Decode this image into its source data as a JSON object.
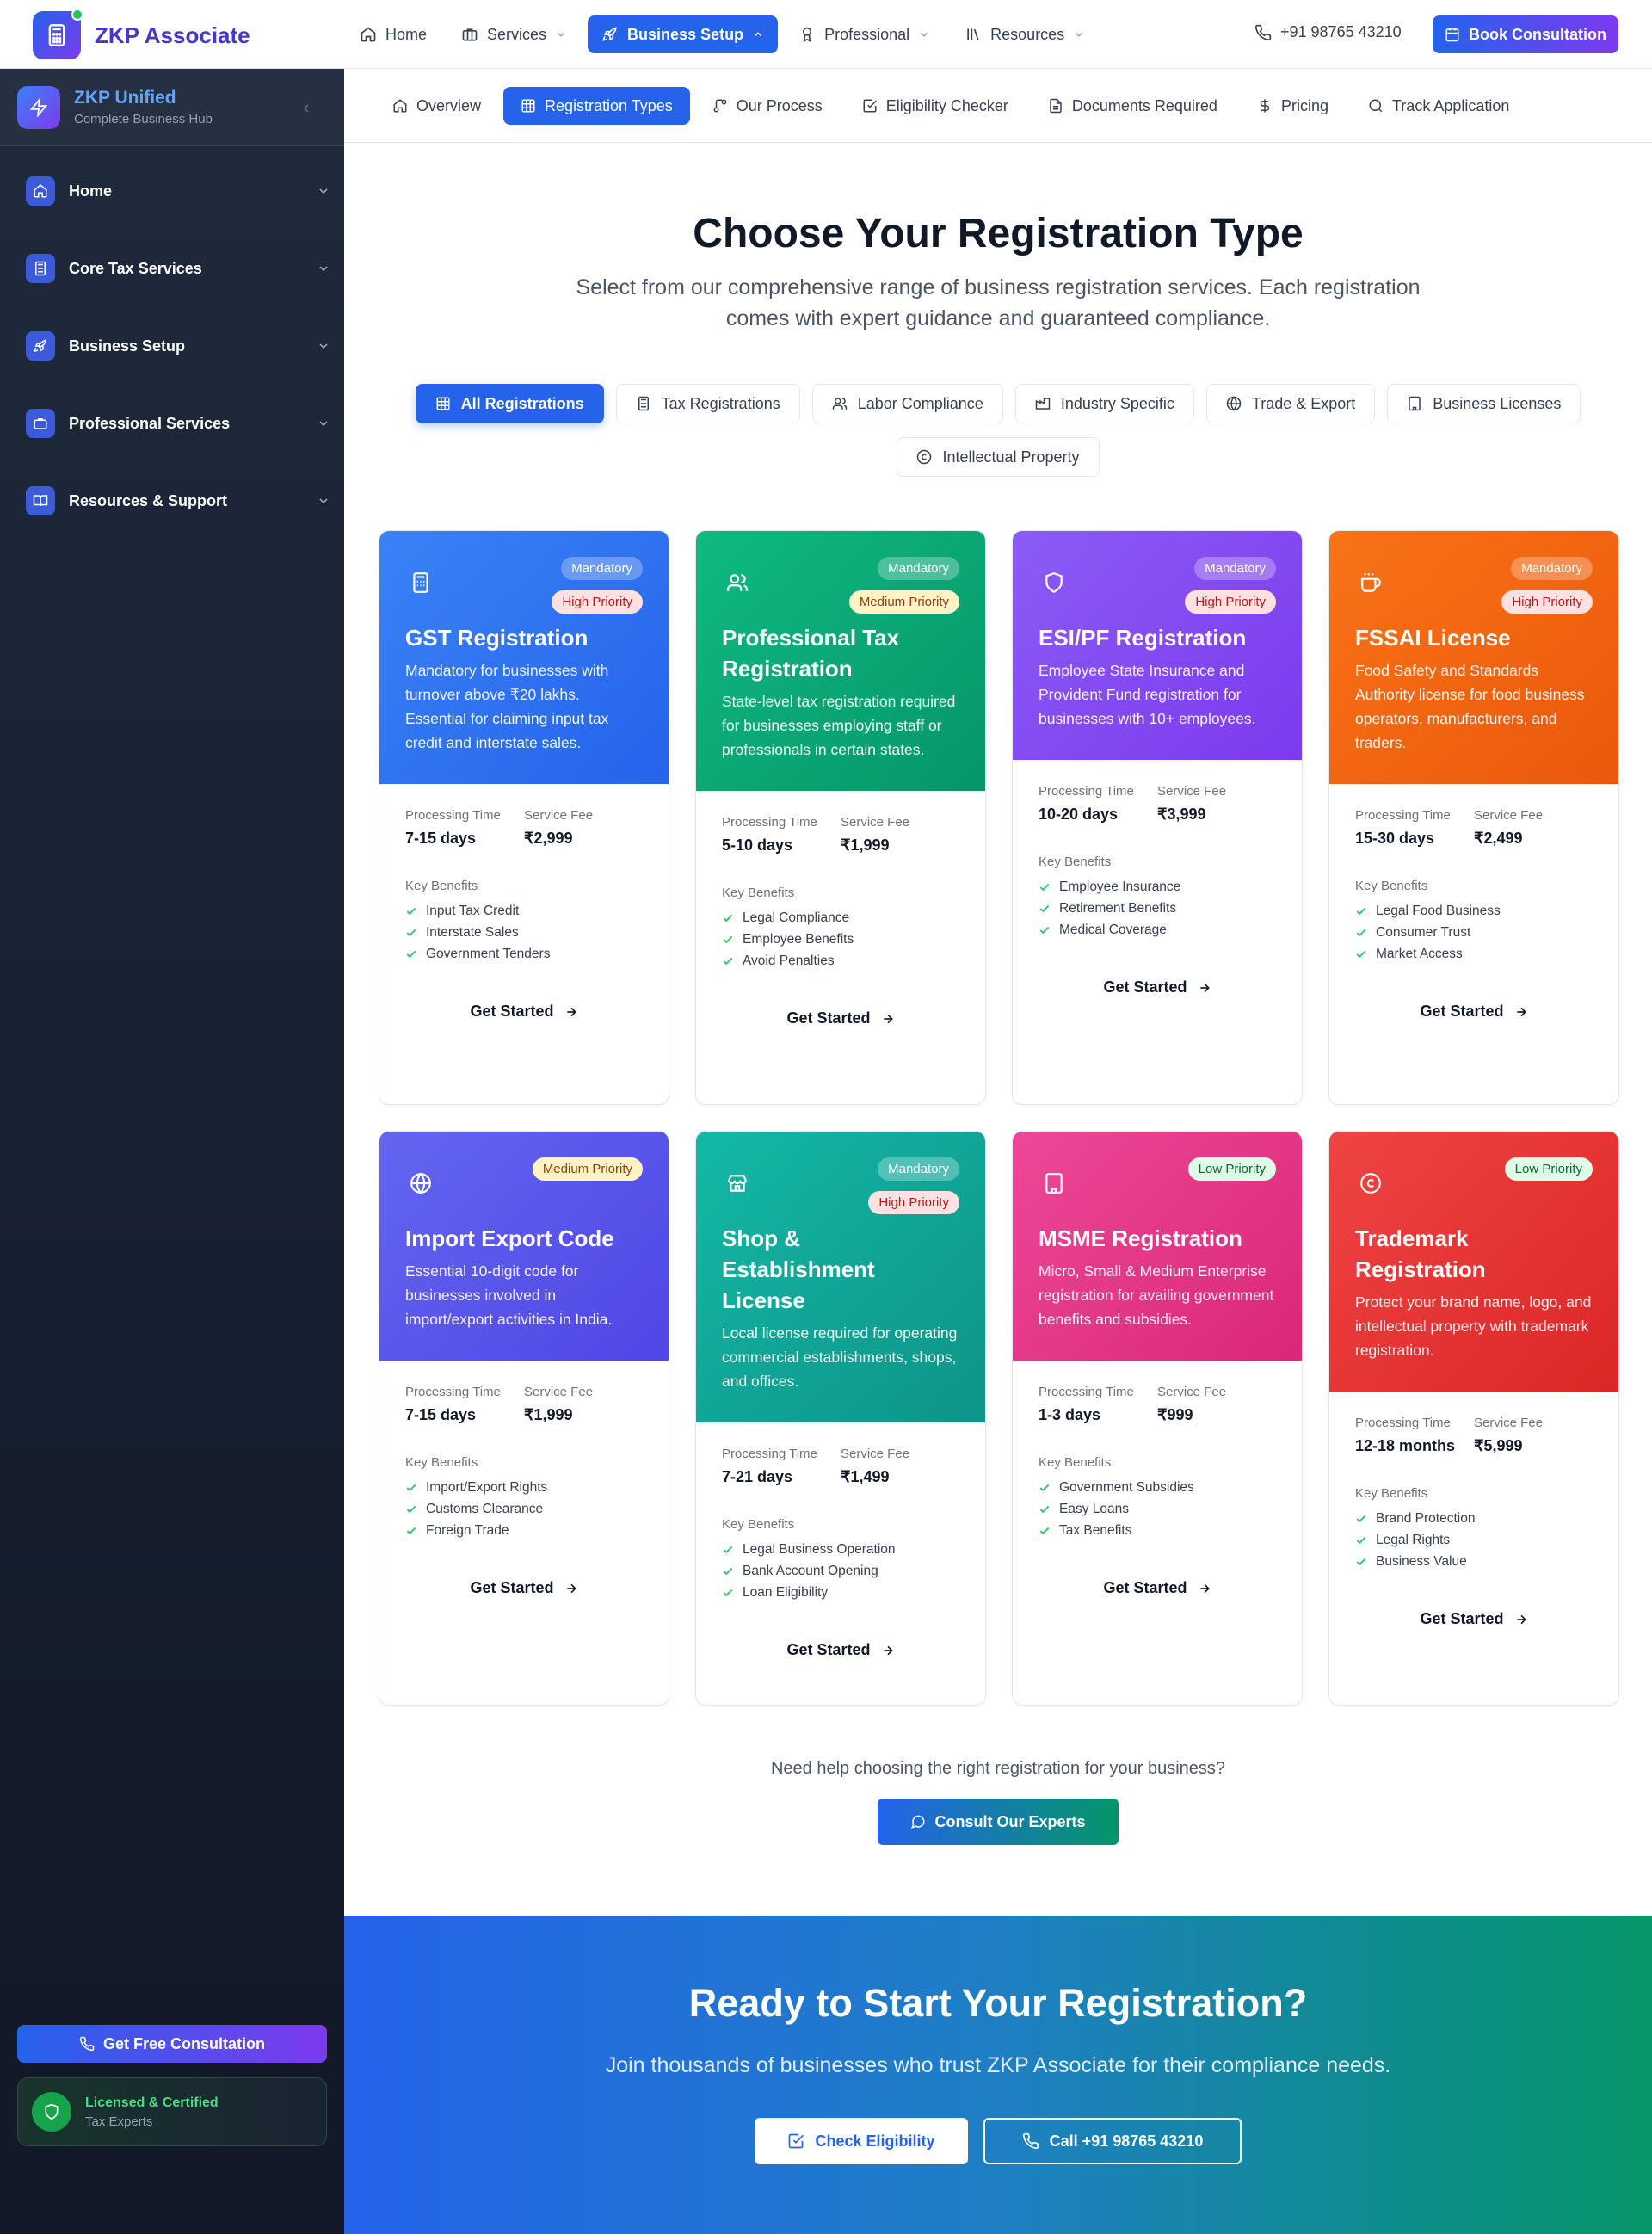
{
  "brand": {
    "name": "ZKP Associate"
  },
  "topnav": {
    "items": [
      {
        "label": "Home",
        "icon": "home-icon"
      },
      {
        "label": "Services",
        "icon": "briefcase-icon"
      },
      {
        "label": "Business Setup",
        "icon": "rocket-icon"
      },
      {
        "label": "Professional",
        "icon": "award-icon"
      },
      {
        "label": "Resources",
        "icon": "library-icon"
      }
    ],
    "active": "Business Setup",
    "phone": "+91 98765 43210",
    "book_label": "Book Consultation"
  },
  "sidebar": {
    "title": "ZKP Unified",
    "subtitle": "Complete Business Hub",
    "items": [
      {
        "label": "Home",
        "icon": "home-icon"
      },
      {
        "label": "Core Tax Services",
        "icon": "calculator-icon"
      },
      {
        "label": "Business Setup",
        "icon": "rocket-icon"
      },
      {
        "label": "Professional Services",
        "icon": "briefcase-icon"
      },
      {
        "label": "Resources & Support",
        "icon": "book-icon"
      }
    ],
    "consult_label": "Get Free Consultation",
    "cert_title": "Licensed & Certified",
    "cert_sub": "Tax Experts"
  },
  "subnav": {
    "tabs": [
      {
        "label": "Overview"
      },
      {
        "label": "Registration Types"
      },
      {
        "label": "Our Process"
      },
      {
        "label": "Eligibility Checker"
      },
      {
        "label": "Documents Required"
      },
      {
        "label": "Pricing"
      },
      {
        "label": "Track Application"
      }
    ],
    "active": "Registration Types"
  },
  "page": {
    "title": "Choose Your Registration Type",
    "lead": "Select from our comprehensive range of business registration services. Each registration comes with expert guidance and guaranteed compliance.",
    "filters": [
      {
        "label": "All Registrations"
      },
      {
        "label": "Tax Registrations"
      },
      {
        "label": "Labor Compliance"
      },
      {
        "label": "Industry Specific"
      },
      {
        "label": "Trade & Export"
      },
      {
        "label": "Business Licenses"
      },
      {
        "label": "Intellectual Property"
      }
    ],
    "active_filter": "All Registrations"
  },
  "labels": {
    "processing_time": "Processing Time",
    "service_fee": "Service Fee",
    "key_benefits": "Key Benefits",
    "get_started": "Get Started"
  },
  "cards": [
    {
      "title": "GST Registration",
      "desc": "Mandatory for businesses with turnover above ₹20 lakhs. Essential for claiming input tax credit and interstate sales.",
      "badges": [
        "Mandatory",
        "High Priority"
      ],
      "time": "7-15 days",
      "fee": "₹2,999",
      "benefits": [
        "Input Tax Credit",
        "Interstate Sales",
        "Government Tenders"
      ],
      "color": "#2563eb",
      "icon": "calculator-icon"
    },
    {
      "title": "Professional Tax Registration",
      "desc": "State-level tax registration required for businesses employing staff or professionals in certain states.",
      "badges": [
        "Mandatory",
        "Medium Priority"
      ],
      "time": "5-10 days",
      "fee": "₹1,999",
      "benefits": [
        "Legal Compliance",
        "Employee Benefits",
        "Avoid Penalties"
      ],
      "color": "#059669",
      "icon": "users-icon"
    },
    {
      "title": "ESI/PF Registration",
      "desc": "Employee State Insurance and Provident Fund registration for businesses with 10+ employees.",
      "badges": [
        "Mandatory",
        "High Priority"
      ],
      "time": "10-20 days",
      "fee": "₹3,999",
      "benefits": [
        "Employee Insurance",
        "Retirement Benefits",
        "Medical Coverage"
      ],
      "color": "#7c3aed",
      "icon": "shield-icon"
    },
    {
      "title": "FSSAI License",
      "desc": "Food Safety and Standards Authority license for food business operators, manufacturers, and traders.",
      "badges": [
        "Mandatory",
        "High Priority"
      ],
      "time": "15-30 days",
      "fee": "₹2,499",
      "benefits": [
        "Legal Food Business",
        "Consumer Trust",
        "Market Access"
      ],
      "color": "#ea580c",
      "icon": "coffee-icon"
    },
    {
      "title": "Import Export Code",
      "desc": "Essential 10-digit code for businesses involved in import/export activities in India.",
      "badges": [
        "Medium Priority"
      ],
      "time": "7-15 days",
      "fee": "₹1,999",
      "benefits": [
        "Import/Export Rights",
        "Customs Clearance",
        "Foreign Trade"
      ],
      "color": "#4f46e5",
      "icon": "globe-icon"
    },
    {
      "title": "Shop & Establishment License",
      "desc": "Local license required for operating commercial establishments, shops, and offices.",
      "badges": [
        "Mandatory",
        "High Priority"
      ],
      "time": "7-21 days",
      "fee": "₹1,499",
      "benefits": [
        "Legal Business Operation",
        "Bank Account Opening",
        "Loan Eligibility"
      ],
      "color": "#0d9488",
      "icon": "store-icon"
    },
    {
      "title": "MSME Registration",
      "desc": "Micro, Small & Medium Enterprise registration for availing government benefits and subsidies.",
      "badges": [
        "Low Priority"
      ],
      "time": "1-3 days",
      "fee": "₹999",
      "benefits": [
        "Government Subsidies",
        "Easy Loans",
        "Tax Benefits"
      ],
      "color": "#db2777",
      "icon": "building-icon"
    },
    {
      "title": "Trademark Registration",
      "desc": "Protect your brand name, logo, and intellectual property with trademark registration.",
      "badges": [
        "Low Priority"
      ],
      "time": "12-18 months",
      "fee": "₹5,999",
      "benefits": [
        "Brand Protection",
        "Legal Rights",
        "Business Value"
      ],
      "color": "#dc2626",
      "icon": "copyright-icon"
    }
  ],
  "help": {
    "text": "Need help choosing the right registration for your business?",
    "button": "Consult Our Experts"
  },
  "cta": {
    "title": "Ready to Start Your Registration?",
    "text": "Join thousands of businesses who trust ZKP Associate for their compliance needs.",
    "check_label": "Check Eligibility",
    "call_label": "Call +91 98765 43210"
  }
}
